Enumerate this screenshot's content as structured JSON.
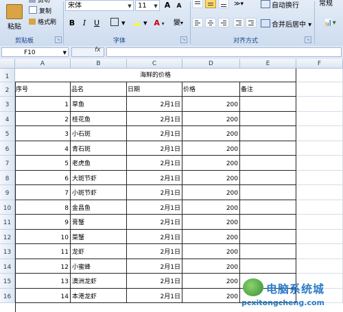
{
  "ribbon": {
    "clipboard": {
      "paste": "粘贴",
      "cut": "剪切",
      "copy": "复制",
      "format_painter": "格式刷",
      "label": "剪贴板"
    },
    "font": {
      "name": "宋体",
      "size": "11",
      "grow": "A",
      "shrink": "A",
      "bold": "B",
      "italic": "I",
      "underline": "U",
      "phonetic": "變",
      "label": "字体"
    },
    "alignment": {
      "wrap": "自动换行",
      "merge": "合并后居中",
      "label": "对齐方式"
    },
    "number": {
      "format": "常规"
    }
  },
  "formula_bar": {
    "name_box": "F10",
    "fx": "fx",
    "value": ""
  },
  "columns": [
    "A",
    "B",
    "C",
    "D",
    "E",
    "F"
  ],
  "rows": [
    "1",
    "2",
    "3",
    "4",
    "5",
    "6",
    "7",
    "8",
    "9",
    "10",
    "11",
    "12",
    "13",
    "14",
    "15",
    "16"
  ],
  "sheet": {
    "title": "海鲜的价格",
    "headers": [
      "序号",
      "品名",
      "日期",
      "价格",
      "备注"
    ],
    "data": [
      {
        "no": "1",
        "name": "草鱼",
        "date": "2月1日",
        "price": "200"
      },
      {
        "no": "2",
        "name": "桂花鱼",
        "date": "2月1日",
        "price": "200"
      },
      {
        "no": "3",
        "name": "小石斑",
        "date": "2月1日",
        "price": "200"
      },
      {
        "no": "4",
        "name": "青石斑",
        "date": "2月1日",
        "price": "200"
      },
      {
        "no": "5",
        "name": "老虎鱼",
        "date": "2月1日",
        "price": "200"
      },
      {
        "no": "6",
        "name": "大斑节虾",
        "date": "2月1日",
        "price": "200"
      },
      {
        "no": "7",
        "name": "小斑节虾",
        "date": "2月1日",
        "price": "200"
      },
      {
        "no": "8",
        "name": "金昌鱼",
        "date": "2月1日",
        "price": "200"
      },
      {
        "no": "9",
        "name": "膏蟹",
        "date": "2月1日",
        "price": "200"
      },
      {
        "no": "10",
        "name": "菜蟹",
        "date": "2月1日",
        "price": "200"
      },
      {
        "no": "11",
        "name": "龙虾",
        "date": "2月1日",
        "price": "200"
      },
      {
        "no": "12",
        "name": "小蜜蜂",
        "date": "2月1日",
        "price": "200"
      },
      {
        "no": "13",
        "name": "澳洲龙虾",
        "date": "2月1日",
        "price": "200"
      },
      {
        "no": "14",
        "name": "本港龙虾",
        "date": "2月1日",
        "price": "200"
      }
    ]
  },
  "watermark": {
    "line1": "电脑系统城",
    "line2": "pcxitongcheng.com"
  },
  "colors": {
    "accent": "#15428b",
    "border": "#222222"
  }
}
